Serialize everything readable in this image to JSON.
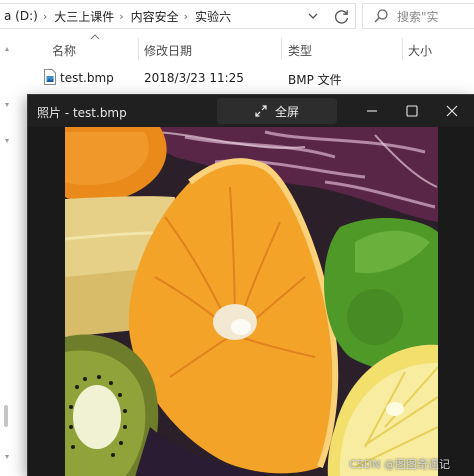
{
  "explorer": {
    "breadcrumb": [
      "a (D:)",
      "大三上课件",
      "内容安全",
      "实验六"
    ],
    "search_placeholder": "搜索\"实",
    "columns": {
      "name": "名称",
      "modified": "修改日期",
      "type": "类型",
      "size": "大小"
    },
    "files": [
      {
        "name": "test.bmp",
        "modified": "2018/3/23 11:25",
        "type": "BMP 文件"
      }
    ]
  },
  "photos": {
    "title": "照片 - test.bmp",
    "fullscreen_label": "全屏",
    "image_icon": "fruits-photo"
  },
  "watermark": "CSDN @图图奇遇记",
  "colors": {
    "photos_bg": "#1f1f1f",
    "titlebar": "#202020",
    "fullscreen_bg": "#2d2d2d",
    "orange": "#f29a1e",
    "lime": "#5aa52c",
    "kiwi": "#6f7d2a",
    "lemon": "#f1de6a"
  }
}
